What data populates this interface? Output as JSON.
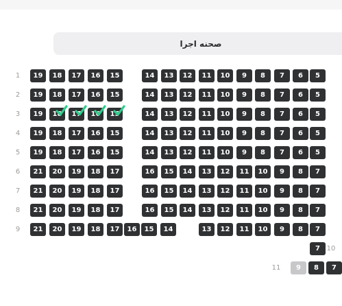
{
  "stage": {
    "label": "صحنه اجرا"
  },
  "colors": {
    "seat": "#2f3133",
    "seat_text": "#ffffff",
    "seat_disabled": "#c8c8ca",
    "selected_check": "#2ecc8a",
    "row_label": "#9b9b9b",
    "stage_bg": "#efeff1"
  },
  "rows": [
    {
      "label": "1",
      "left": [
        "19",
        "18",
        "17",
        "16",
        "15"
      ],
      "right": [
        "14",
        "13",
        "12",
        "11",
        "10",
        "9",
        "8",
        "7",
        "6",
        "5"
      ]
    },
    {
      "label": "2",
      "left": [
        "19",
        "18",
        "17",
        "16",
        "15"
      ],
      "right": [
        "14",
        "13",
        "12",
        "11",
        "10",
        "9",
        "8",
        "7",
        "6",
        "5"
      ]
    },
    {
      "label": "3",
      "left": [
        "19",
        "18",
        "17",
        "16",
        "15"
      ],
      "right": [
        "14",
        "13",
        "12",
        "11",
        "10",
        "9",
        "8",
        "7",
        "6",
        "5"
      ],
      "selected": [
        "18",
        "17",
        "16",
        "15"
      ]
    },
    {
      "label": "4",
      "left": [
        "19",
        "18",
        "17",
        "16",
        "15"
      ],
      "right": [
        "14",
        "13",
        "12",
        "11",
        "10",
        "9",
        "8",
        "7",
        "6",
        "5"
      ]
    },
    {
      "label": "5",
      "left": [
        "19",
        "18",
        "17",
        "16",
        "15"
      ],
      "right": [
        "14",
        "13",
        "12",
        "11",
        "10",
        "9",
        "8",
        "7",
        "6",
        "5"
      ]
    },
    {
      "label": "6",
      "left": [
        "21",
        "20",
        "19",
        "18",
        "17"
      ],
      "right": [
        "16",
        "15",
        "14",
        "13",
        "12",
        "11",
        "10",
        "9",
        "8",
        "7"
      ]
    },
    {
      "label": "7",
      "left": [
        "21",
        "20",
        "19",
        "18",
        "17"
      ],
      "right": [
        "16",
        "15",
        "14",
        "13",
        "12",
        "11",
        "10",
        "9",
        "8",
        "7"
      ]
    },
    {
      "label": "8",
      "left": [
        "21",
        "20",
        "19",
        "18",
        "17"
      ],
      "right": [
        "16",
        "15",
        "14",
        "13",
        "12",
        "11",
        "10",
        "9",
        "8",
        "7"
      ]
    },
    {
      "label": "9",
      "left": [
        "21",
        "20",
        "19",
        "18",
        "17",
        "16",
        "15",
        "14"
      ],
      "right": [
        "13",
        "12",
        "11",
        "10",
        "9",
        "8",
        "7"
      ]
    },
    {
      "label": "10",
      "right": [
        "7"
      ]
    },
    {
      "label": "11",
      "right": [
        "9",
        "8",
        "7"
      ],
      "disabled": [
        "9"
      ]
    }
  ]
}
